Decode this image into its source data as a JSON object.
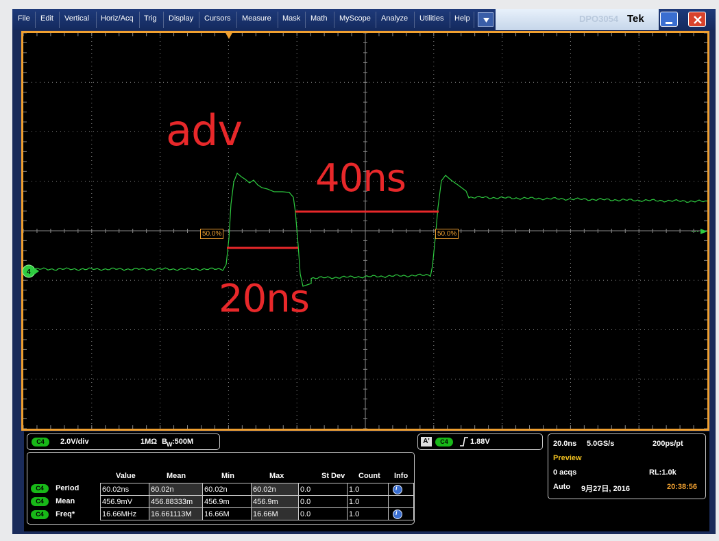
{
  "menu": [
    "File",
    "Edit",
    "Vertical",
    "Horiz/Acq",
    "Trig",
    "Display",
    "Cursors",
    "Measure",
    "Mask",
    "Math",
    "MyScope",
    "Analyze",
    "Utilities",
    "Help"
  ],
  "title_ghost": "DPO3054",
  "brand": "Tek",
  "channel_marker": "4",
  "tags": {
    "left": "50.0%",
    "right": "50.0%"
  },
  "annotations": {
    "adv": "adv",
    "top": "40ns",
    "bottom": "20ns"
  },
  "vertical": {
    "channel": "C4",
    "scale": "2.0V/div",
    "coupling": "1MΩ",
    "bw_sym": "B",
    "bw_sub": "W",
    "bw_value": ":500M"
  },
  "trigger": {
    "a_label": "A'",
    "channel": "C4",
    "level": "1.88V"
  },
  "measurements": {
    "headers": [
      "Value",
      "Mean",
      "Min",
      "Max",
      "St Dev",
      "Count",
      "Info"
    ],
    "rows": [
      {
        "ch": "C4",
        "name": "Period",
        "value": "60.02ns",
        "mean": "60.02n",
        "min": "60.02n",
        "max": "60.02n",
        "stdev": "0.0",
        "count": "1.0",
        "info": true
      },
      {
        "ch": "C4",
        "name": "Mean",
        "value": "456.9mV",
        "mean": "456.88333m",
        "min": "456.9m",
        "max": "456.9m",
        "stdev": "0.0",
        "count": "1.0",
        "info": false
      },
      {
        "ch": "C4",
        "name": "Freq*",
        "value": "16.66MHz",
        "mean": "16.661113M",
        "min": "16.66M",
        "max": "16.66M",
        "stdev": "0.0",
        "count": "1.0",
        "info": true
      }
    ]
  },
  "horizontal": {
    "scale": "20.0ns",
    "rate": "5.0GS/s",
    "per_pt": "200ps/pt",
    "mode": "Preview",
    "acqs": "0 acqs",
    "rl": "RL:1.0k",
    "trig_mode": "Auto",
    "date": "9月27日, 2016",
    "time": "20:38:56"
  },
  "colors": {
    "trace": "#2ecc40",
    "graticule": "#8a8a8a",
    "accent": "#f0a030",
    "annotation": "#e8282a"
  }
}
